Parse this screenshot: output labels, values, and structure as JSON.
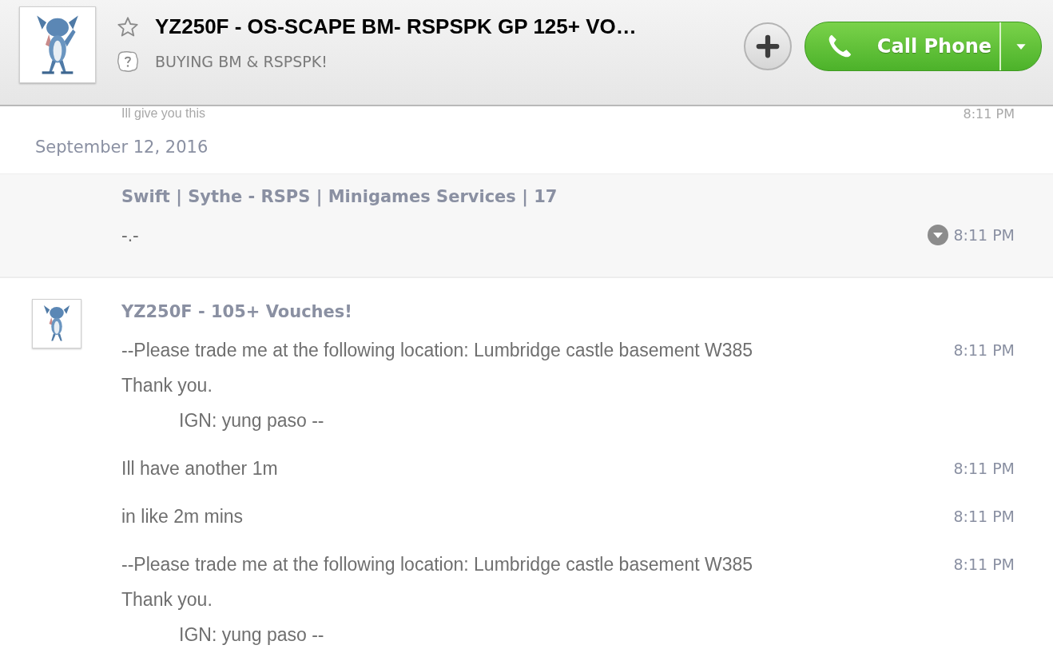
{
  "header": {
    "title": "YZ250F - OS-SCAPE BM- RSPSPK GP 125+ VO…",
    "starred": false,
    "mood": "BUYING BM & RSPSPK!",
    "call_button": "Call Phone"
  },
  "faded_message": {
    "text": "Ill give you this",
    "time": "8:11 PM"
  },
  "date_separator": "September 12, 2016",
  "groups": [
    {
      "sender": "Swift | Sythe - RSPS | Minigames Services | 17",
      "has_avatar": false,
      "highlighted": true,
      "messages": [
        {
          "lines": [
            {
              "text": "-.-",
              "indented": false
            }
          ],
          "time": "8:11 PM",
          "menu": true
        }
      ]
    },
    {
      "sender": "YZ250F - 105+ Vouches!",
      "has_avatar": true,
      "highlighted": false,
      "messages": [
        {
          "lines": [
            {
              "text": "--Please trade me at the following location: Lumbridge castle basement W385",
              "indented": false
            },
            {
              "text": "Thank you.",
              "indented": false
            },
            {
              "text": "IGN: yung paso --",
              "indented": true
            }
          ],
          "time": "8:11 PM",
          "menu": false
        },
        {
          "lines": [
            {
              "text": "Ill have another 1m",
              "indented": false
            }
          ],
          "time": "8:11 PM",
          "menu": false
        },
        {
          "lines": [
            {
              "text": "in like 2m mins",
              "indented": false
            }
          ],
          "time": "8:11 PM",
          "menu": false
        },
        {
          "lines": [
            {
              "text": "--Please trade me at the following location: Lumbridge castle basement W385",
              "indented": false
            },
            {
              "text": "Thank you.",
              "indented": false
            },
            {
              "text": "IGN: yung paso --",
              "indented": true
            }
          ],
          "time": "8:11 PM",
          "menu": false
        }
      ]
    }
  ]
}
